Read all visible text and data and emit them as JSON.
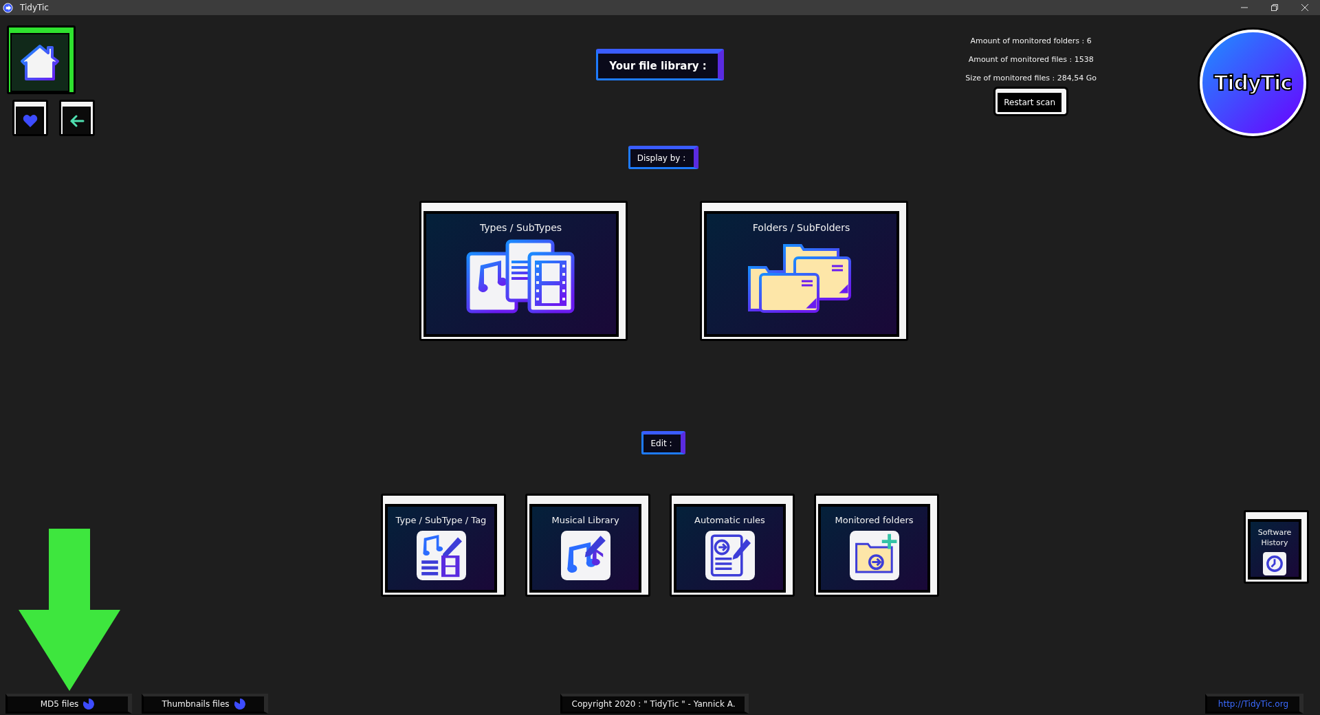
{
  "window": {
    "title": "TidyTic"
  },
  "nav": [
    {
      "kind": "home",
      "selected": true
    },
    {
      "kind": "favorites",
      "selected": false
    },
    {
      "kind": "back",
      "selected": false
    }
  ],
  "library_title": "Your file library :",
  "stats": [
    "Amount of monitored folders : 6",
    "Amount of monitored files : 1538",
    "Size of monitored files : 284,54 Go"
  ],
  "restart_button": "Restart scan",
  "logo": "TidyTic",
  "display_label": "Display by :",
  "display_options": [
    {
      "label": "Types / SubTypes",
      "kind": "types"
    },
    {
      "label": "Folders / SubFolders",
      "kind": "folders"
    }
  ],
  "edit_label": "Edit :",
  "edit_options": [
    {
      "label": "Type / SubType / Tag",
      "kind": "tags"
    },
    {
      "label": "Musical Library",
      "kind": "music"
    },
    {
      "label": "Automatic rules",
      "kind": "rules"
    },
    {
      "label": "Monitored folders",
      "kind": "monitored"
    }
  ],
  "software_history": "Software History",
  "status_bar": {
    "tasks": [
      "MD5 files",
      "Thumbnails files"
    ],
    "copyright": "Copyright 2020 : \" TidyTic \" - Yannick A.",
    "link": "http://TidyTic.org"
  }
}
